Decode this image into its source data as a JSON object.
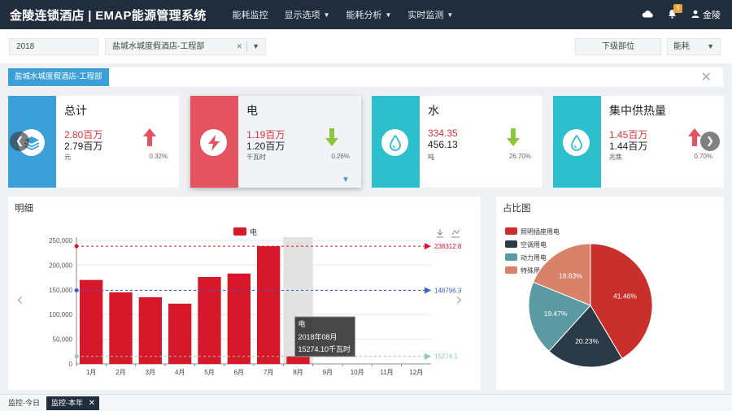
{
  "header": {
    "brand": "金陵连锁酒店 | EMAP能源管理系统",
    "nav": [
      {
        "label": "能耗监控",
        "caret": false
      },
      {
        "label": "显示选项",
        "caret": true
      },
      {
        "label": "能耗分析",
        "caret": true
      },
      {
        "label": "实时监测",
        "caret": true
      }
    ],
    "notification_count": "5",
    "user_name": "金陵"
  },
  "filters": {
    "year": "2018",
    "org": "盐城水城度假酒店-工程部",
    "sub_unit": "下级部位",
    "type": "能耗"
  },
  "tag": {
    "label": "盐城水城度假酒店-工程部"
  },
  "cards": [
    {
      "title": "总计",
      "v1": "2.80百万",
      "v2": "2.79百万",
      "unit": "元",
      "pct": "0.32%",
      "trend": "up",
      "color": "#3ba0d8"
    },
    {
      "title": "电",
      "v1": "1.19百万",
      "v2": "1.20百万",
      "unit": "千瓦时",
      "pct": "0.26%",
      "trend": "down",
      "color": "#e35360"
    },
    {
      "title": "水",
      "v1": "334.35",
      "v2": "456.13",
      "unit": "吨",
      "pct": "26.70%",
      "trend": "down",
      "color": "#2dbfcc"
    },
    {
      "title": "集中供热量",
      "v1": "1.45百万",
      "v2": "1.44百万",
      "unit": "兆焦",
      "pct": "0.70%",
      "trend": "up",
      "color": "#2dbfcc"
    }
  ],
  "colors": {
    "up": "#e35360",
    "down": "#8cc63e",
    "bar": "#d7182a",
    "bar_highlight": "#d9d9d9"
  },
  "detail_panel": {
    "title": "明细"
  },
  "pie_panel": {
    "title": "占比图"
  },
  "chart_data": [
    {
      "type": "bar",
      "legend": "电",
      "categories": [
        "1月",
        "2月",
        "3月",
        "4月",
        "5月",
        "6月",
        "7月",
        "8月",
        "9月",
        "10月",
        "11月",
        "12月"
      ],
      "values": [
        170000,
        145000,
        135000,
        122000,
        176000,
        183000,
        238312.8,
        15274.1,
        null,
        null,
        null,
        null
      ],
      "ylim": [
        0,
        250000
      ],
      "yticks": [
        "0",
        "50,000",
        "100,000",
        "150,000",
        "200,000",
        "250,000"
      ],
      "markLines": [
        {
          "value": 238312.8,
          "label": "238312.8",
          "color": "#d7182a"
        },
        {
          "value": 148796.3,
          "label": "148796.3",
          "color": "#3a5fcd"
        },
        {
          "value": 15274.1,
          "label": "15274.1",
          "color": "#8ecfa8"
        }
      ],
      "tooltip": {
        "series": "电",
        "period": "2018年08月",
        "value": "15274.10千瓦时"
      }
    },
    {
      "type": "pie",
      "series": [
        {
          "name": "照明插座用电",
          "value": 41.46,
          "label": "41.46%",
          "color": "#c9302c"
        },
        {
          "name": "空调用电",
          "value": 20.23,
          "label": "20.23%",
          "color": "#2b3a47"
        },
        {
          "name": "动力用电",
          "value": 19.47,
          "label": "19.47%",
          "color": "#5b9aa3"
        },
        {
          "name": "特殊用电",
          "value": 18.83,
          "label": "18.83%",
          "color": "#d9826a"
        }
      ]
    }
  ],
  "bottom_tabs": [
    {
      "label": "监控-今日",
      "active": false
    },
    {
      "label": "监控-本年",
      "active": true
    }
  ]
}
